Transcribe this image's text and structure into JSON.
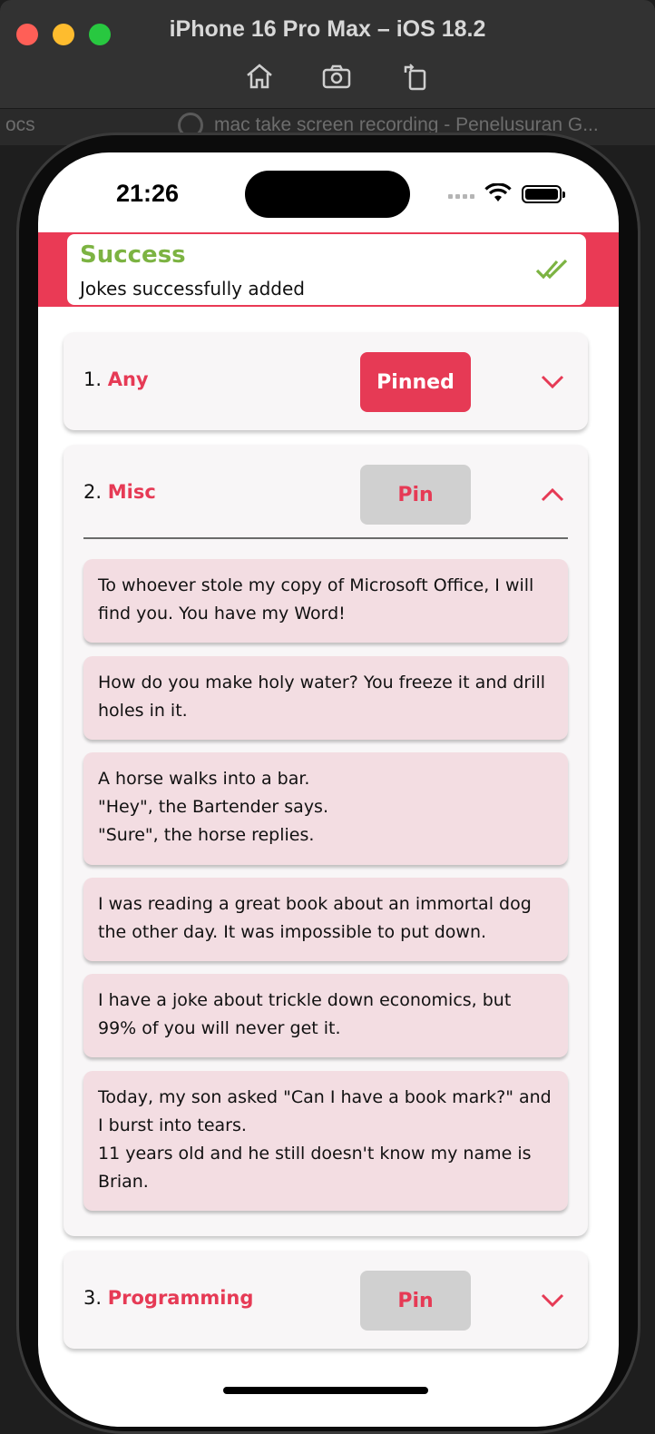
{
  "simulator": {
    "title": "iPhone 16 Pro Max – iOS 18.2",
    "background_left_text": "ocs",
    "background_tab_text": "mac take screen recording - Penelusuran G..."
  },
  "status_bar": {
    "time": "21:26"
  },
  "toast": {
    "title": "Success",
    "message": "Jokes successfully added",
    "accent_color": "#ea3a55",
    "title_color": "#7cb342"
  },
  "categories": [
    {
      "number": "1.",
      "name": "Any",
      "pin_label": "Pinned",
      "pinned": true,
      "expanded": false
    },
    {
      "number": "2.",
      "name": "Misc",
      "pin_label": "Pin",
      "pinned": false,
      "expanded": true
    },
    {
      "number": "3.",
      "name": "Programming",
      "pin_label": "Pin",
      "pinned": false,
      "expanded": false
    }
  ],
  "jokes": [
    "To whoever stole my copy of Microsoft Office, I will find you. You have my Word!",
    "How do you make holy water? You freeze it and drill holes in it.",
    "A horse walks into a bar.\n\"Hey\", the Bartender says.\n\"Sure\", the horse replies.",
    "I was reading a great book about an immortal dog the other day. It was impossible to put down.",
    "I have a joke about trickle down economics, but 99% of you will never get it.",
    "Today, my son asked \"Can I have a book mark?\" and I burst into tears.\n11 years old and he still doesn't know my name is Brian."
  ]
}
